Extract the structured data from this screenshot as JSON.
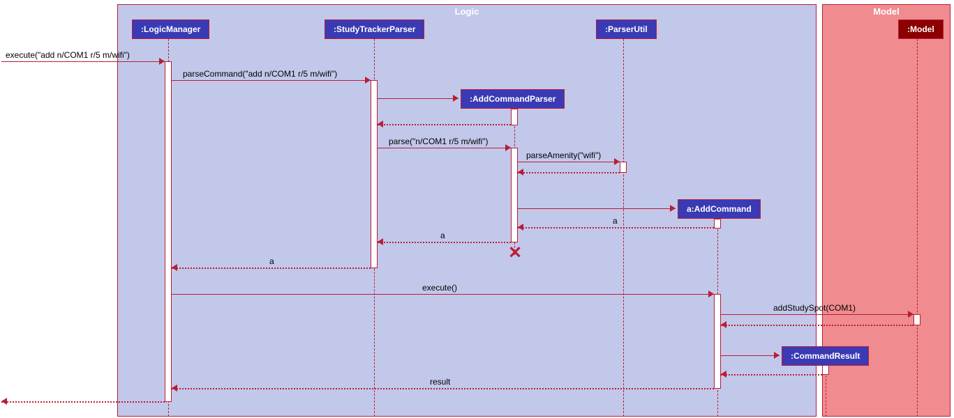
{
  "packages": {
    "logic": "Logic",
    "model": "Model"
  },
  "participants": {
    "logicManager": ":LogicManager",
    "studyTrackerParser": ":StudyTrackerParser",
    "addCommandParser": ":AddCommandParser",
    "parserUtil": ":ParserUtil",
    "addCommand": "a:AddCommand",
    "commandResult": ":CommandResult",
    "model": ":Model"
  },
  "messages": {
    "execute1": "execute(\"add n/COM1 r/5 m/wifi\")",
    "parseCommand": "parseCommand(\"add n/COM1 r/5 m/wifi\")",
    "parse": "parse(\"n/COM1 r/5 m/wifi\")",
    "parseAmenity": "parseAmenity(\"wifi\")",
    "returnA1": "a",
    "returnA2": "a",
    "returnA3": "a",
    "execute2": "execute()",
    "addStudySpot": "addStudySpot(COM1)",
    "result": "result"
  },
  "chart_data": {
    "type": "sequence_diagram",
    "packages": [
      {
        "name": "Logic",
        "participants": [
          "LogicManager",
          "StudyTrackerParser",
          "AddCommandParser",
          "ParserUtil",
          "a:AddCommand",
          "CommandResult"
        ]
      },
      {
        "name": "Model",
        "participants": [
          "Model"
        ]
      }
    ],
    "messages": [
      {
        "from": "external",
        "to": "LogicManager",
        "label": "execute(\"add n/COM1 r/5 m/wifi\")",
        "type": "sync"
      },
      {
        "from": "LogicManager",
        "to": "StudyTrackerParser",
        "label": "parseCommand(\"add n/COM1 r/5 m/wifi\")",
        "type": "sync"
      },
      {
        "from": "StudyTrackerParser",
        "to": "AddCommandParser",
        "label": "create",
        "type": "create"
      },
      {
        "from": "AddCommandParser",
        "to": "StudyTrackerParser",
        "label": "",
        "type": "return"
      },
      {
        "from": "StudyTrackerParser",
        "to": "AddCommandParser",
        "label": "parse(\"n/COM1 r/5 m/wifi\")",
        "type": "sync"
      },
      {
        "from": "AddCommandParser",
        "to": "ParserUtil",
        "label": "parseAmenity(\"wifi\")",
        "type": "sync"
      },
      {
        "from": "ParserUtil",
        "to": "AddCommandParser",
        "label": "",
        "type": "return"
      },
      {
        "from": "AddCommandParser",
        "to": "a:AddCommand",
        "label": "create",
        "type": "create"
      },
      {
        "from": "a:AddCommand",
        "to": "AddCommandParser",
        "label": "a",
        "type": "return"
      },
      {
        "from": "AddCommandParser",
        "to": "StudyTrackerParser",
        "label": "a",
        "type": "return"
      },
      {
        "from": "AddCommandParser",
        "to": "",
        "label": "destroy",
        "type": "destroy"
      },
      {
        "from": "StudyTrackerParser",
        "to": "LogicManager",
        "label": "a",
        "type": "return"
      },
      {
        "from": "LogicManager",
        "to": "a:AddCommand",
        "label": "execute()",
        "type": "sync"
      },
      {
        "from": "a:AddCommand",
        "to": "Model",
        "label": "addStudySpot(COM1)",
        "type": "sync"
      },
      {
        "from": "Model",
        "to": "a:AddCommand",
        "label": "",
        "type": "return"
      },
      {
        "from": "a:AddCommand",
        "to": "CommandResult",
        "label": "create",
        "type": "create"
      },
      {
        "from": "CommandResult",
        "to": "a:AddCommand",
        "label": "",
        "type": "return"
      },
      {
        "from": "a:AddCommand",
        "to": "LogicManager",
        "label": "result",
        "type": "return"
      },
      {
        "from": "LogicManager",
        "to": "external",
        "label": "",
        "type": "return"
      }
    ]
  }
}
